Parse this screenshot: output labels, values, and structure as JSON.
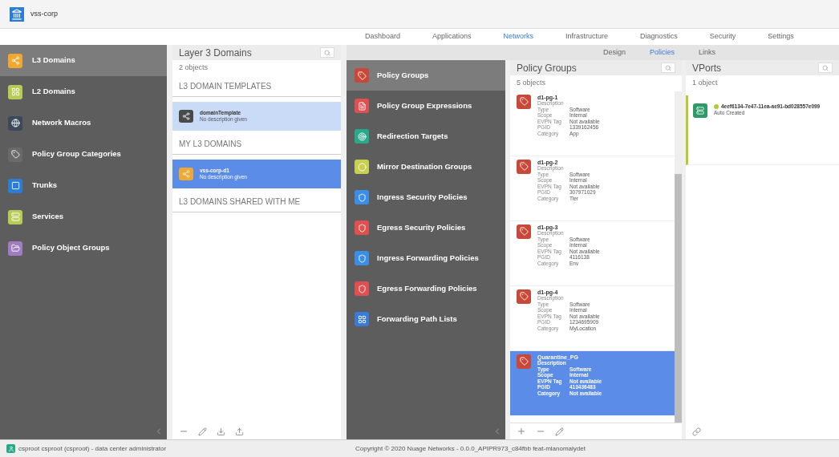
{
  "header": {
    "title": "vss-corp"
  },
  "nav_tabs": [
    {
      "label": "Dashboard",
      "selected": false
    },
    {
      "label": "Applications",
      "selected": false
    },
    {
      "label": "Networks",
      "selected": true
    },
    {
      "label": "Infrastructure",
      "selected": false
    },
    {
      "label": "Diagnostics",
      "selected": false
    },
    {
      "label": "Security",
      "selected": false
    },
    {
      "label": "Settings",
      "selected": false
    }
  ],
  "sidebar": {
    "items": [
      {
        "label": "L3 Domains",
        "selected": true,
        "color": "#f0a830"
      },
      {
        "label": "L2 Domains",
        "selected": false,
        "color": "#b8cc55"
      },
      {
        "label": "Network Macros",
        "selected": false,
        "color": "#3b4a5a"
      },
      {
        "label": "Policy Group Categories",
        "selected": false,
        "color": "#6a6a6a"
      },
      {
        "label": "Trunks",
        "selected": false,
        "color": "#2a7ed8"
      },
      {
        "label": "Services",
        "selected": false,
        "color": "#b8cc55"
      },
      {
        "label": "Policy Object Groups",
        "selected": false,
        "color": "#a07cc0"
      }
    ]
  },
  "domains_panel": {
    "title": "Layer 3 Domains",
    "count": "2 objects",
    "sections": [
      {
        "title": "L3 DOMAIN TEMPLATES",
        "kind": "templates",
        "items": [
          {
            "name": "domainTemplate",
            "description": "No description given",
            "selected": false,
            "color": "#4a4a4a"
          }
        ]
      },
      {
        "title": "MY L3 DOMAINS",
        "items": [
          {
            "name": "vss-corp-d1",
            "description": "No description given",
            "selected": true,
            "color": "#f0a830"
          }
        ]
      },
      {
        "title": "L3 DOMAINS SHARED WITH ME"
      }
    ]
  },
  "sub_tabs": [
    {
      "label": "Design",
      "selected": false
    },
    {
      "label": "Policies",
      "selected": true
    },
    {
      "label": "Links",
      "selected": false
    }
  ],
  "policy_menu": [
    {
      "label": "Policy Groups",
      "selected": true,
      "color": "#c8483a"
    },
    {
      "label": "Policy Group Expressions",
      "selected": false,
      "color": "#e05050"
    },
    {
      "label": "Redirection Targets",
      "selected": false,
      "color": "#2aa88a"
    },
    {
      "label": "Mirror Destination Groups",
      "selected": false,
      "color": "#c8d050"
    },
    {
      "label": "Ingress Security Policies",
      "selected": false,
      "color": "#3a8ee8"
    },
    {
      "label": "Egress Security Policies",
      "selected": false,
      "color": "#e05050"
    },
    {
      "label": "Ingress Forwarding Policies",
      "selected": false,
      "color": "#3a8ee8"
    },
    {
      "label": "Egress Forwarding Policies",
      "selected": false,
      "color": "#e05050"
    },
    {
      "label": "Forwarding Path Lists",
      "selected": false,
      "color": "#3a7ad8"
    }
  ],
  "policy_groups": {
    "title": "Policy Groups",
    "count": "5 objects",
    "items": [
      {
        "name": "d1-pg-1",
        "selected": false,
        "fields": [
          {
            "label": "Description"
          },
          {
            "label": "Type",
            "value": "Software"
          },
          {
            "label": "Scope",
            "value": "Internal"
          },
          {
            "label": "EVPN Tag",
            "value": "Not available"
          },
          {
            "label": "PGID",
            "value": "1339162456"
          },
          {
            "label": "Category",
            "value": "App"
          }
        ]
      },
      {
        "name": "d1-pg-2",
        "selected": false,
        "fields": [
          {
            "label": "Description"
          },
          {
            "label": "Type",
            "value": "Software"
          },
          {
            "label": "Scope",
            "value": "Internal"
          },
          {
            "label": "EVPN Tag",
            "value": "Not available"
          },
          {
            "label": "PGID",
            "value": "307971029"
          },
          {
            "label": "Category",
            "value": "Tier"
          }
        ]
      },
      {
        "name": "d1-pg-3",
        "selected": false,
        "fields": [
          {
            "label": "Description"
          },
          {
            "label": "Type",
            "value": "Software"
          },
          {
            "label": "Scope",
            "value": "Internal"
          },
          {
            "label": "EVPN Tag",
            "value": "Not available"
          },
          {
            "label": "PGID",
            "value": "4116138"
          },
          {
            "label": "Category",
            "value": "Env"
          }
        ]
      },
      {
        "name": "d1-pg-4",
        "selected": false,
        "fields": [
          {
            "label": "Description"
          },
          {
            "label": "Type",
            "value": "Software"
          },
          {
            "label": "Scope",
            "value": "Internal"
          },
          {
            "label": "EVPN Tag",
            "value": "Not available"
          },
          {
            "label": "PGID",
            "value": "1234695909"
          },
          {
            "label": "Category",
            "value": "MyLocation"
          }
        ]
      },
      {
        "name": "Quarantine_PG",
        "selected": true,
        "fields": [
          {
            "label": "Description"
          },
          {
            "label": "Type",
            "value": "Software"
          },
          {
            "label": "Scope",
            "value": "Internal"
          },
          {
            "label": "EVPN Tag",
            "value": "Not available"
          },
          {
            "label": "PGID",
            "value": "413436483"
          },
          {
            "label": "Category",
            "value": "Not available"
          }
        ]
      }
    ]
  },
  "vports": {
    "title": "VPorts",
    "count": "1 object",
    "items": [
      {
        "name": "4eef6134-7e47-11ea-ae91-bd028557e099",
        "subtitle": "Auto Created",
        "color": "#b0cc30"
      }
    ]
  },
  "status_bar": {
    "user": "csproot csproot (csproot) - data center administrator",
    "copyright": "Copyright © 2020 Nuage Networks - 0.0.0_APIPR973_c84fbb feat-mlanomalydet"
  }
}
